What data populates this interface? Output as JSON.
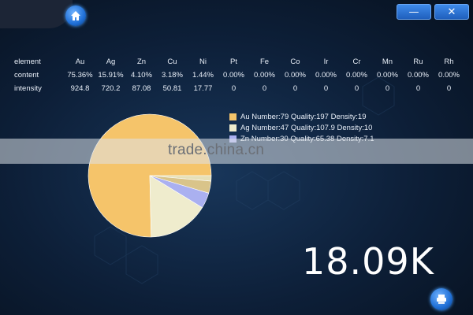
{
  "window": {
    "minimize_label": "—",
    "close_label": "✕",
    "home_icon": "home-icon",
    "bottom_icon": "printer-icon"
  },
  "table": {
    "row_labels": [
      "element",
      "content",
      "intensity"
    ],
    "elements": [
      "Au",
      "Ag",
      "Zn",
      "Cu",
      "Ni",
      "Pt",
      "Fe",
      "Co",
      "Ir",
      "Cr",
      "Mn",
      "Ru",
      "Rh"
    ],
    "content": [
      "75.36%",
      "15.91%",
      "4.10%",
      "3.18%",
      "1.44%",
      "0.00%",
      "0.00%",
      "0.00%",
      "0.00%",
      "0.00%",
      "0.00%",
      "0.00%",
      "0.00%"
    ],
    "intensity": [
      "924.8",
      "720.2",
      "87.08",
      "50.81",
      "17.77",
      "0",
      "0",
      "0",
      "0",
      "0",
      "0",
      "0",
      "0"
    ]
  },
  "legend": [
    {
      "text": "Au Number:79 Quality:197 Density:19",
      "color": "#f5c46a"
    },
    {
      "text": "Ag Number:47 Quality:107.9 Density:10",
      "color": "#efeccd"
    },
    {
      "text": "Zn Number:30 Quality:65.38 Density:7.1",
      "color": "#aab0f0"
    }
  ],
  "pie": {
    "values": [
      75.36,
      15.91,
      4.1,
      3.18,
      1.44
    ],
    "colors": [
      "#f5c46a",
      "#efeccd",
      "#aab0f0",
      "#d9c48a",
      "#e6e0b8"
    ]
  },
  "watermark": "trade.china.cn",
  "big_value": "18.09K"
}
